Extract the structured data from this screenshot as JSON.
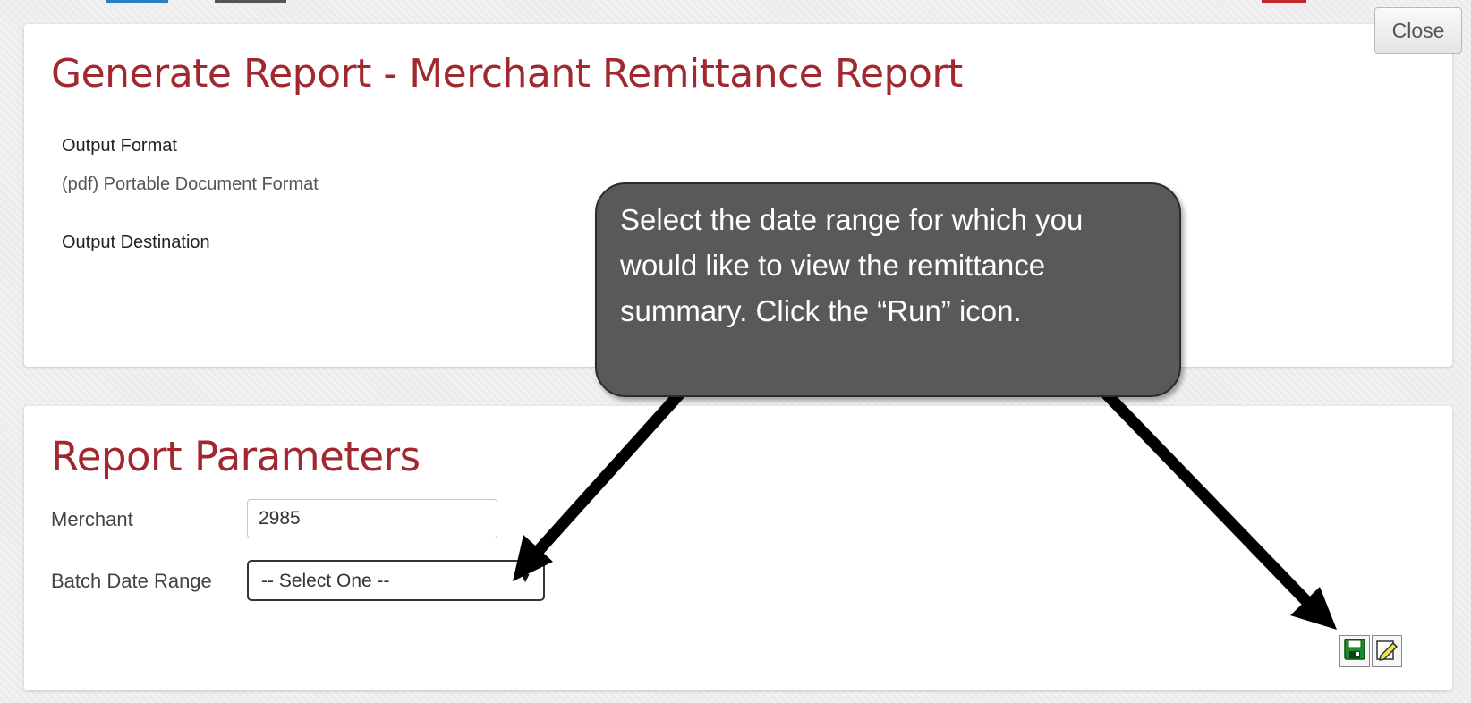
{
  "generate_panel": {
    "title": "Generate Report - Merchant Remittance Report",
    "output_format_label": "Output Format",
    "output_format_value": "(pdf) Portable Document Format",
    "output_destination_label": "Output Destination"
  },
  "params_panel": {
    "title": "Report Parameters",
    "merchant_label": "Merchant",
    "merchant_value": "2985",
    "batch_date_label": "Batch Date Range",
    "batch_date_selected": "-- Select One --"
  },
  "close_label": "Close",
  "callout_text": "Select the date range for which you would like to view the remittance summary. Click the “Run” icon.",
  "icons": {
    "save": "save-icon",
    "run": "run-icon",
    "dropdown": "chevron-down-icon"
  },
  "colors": {
    "title": "#a0282e",
    "callout_bg": "#595959",
    "callout_border": "#2b2b2b",
    "arrow": "#000000",
    "save_icon": "#1e8a2e"
  }
}
